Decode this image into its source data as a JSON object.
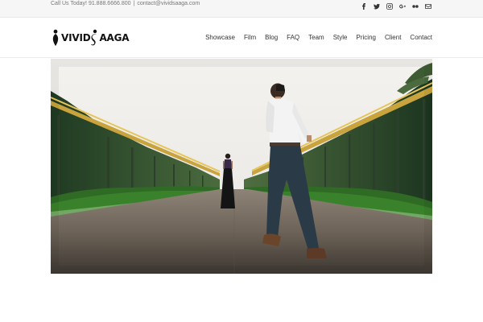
{
  "topbar": {
    "phone_text": "Call Us Today! 91.888.6666.800",
    "separator": "|",
    "email_text": "contact@vividsaaga.com",
    "social_icons": [
      "facebook-icon",
      "twitter-icon",
      "instagram-icon",
      "google-plus-icon",
      "flickr-icon",
      "email-icon"
    ]
  },
  "header": {
    "logo_text_left": "VIVID",
    "logo_text_right": "AAGA",
    "nav": [
      {
        "label": "Showcase"
      },
      {
        "label": "Film"
      },
      {
        "label": "Blog"
      },
      {
        "label": "FAQ"
      },
      {
        "label": "Team"
      },
      {
        "label": "Style"
      },
      {
        "label": "Pricing"
      },
      {
        "label": "Client"
      },
      {
        "label": "Contact"
      }
    ]
  },
  "colors": {
    "topbar_bg": "#f6f6f6",
    "nav_text": "#333333",
    "accent_pergola": "#d8b64a"
  }
}
